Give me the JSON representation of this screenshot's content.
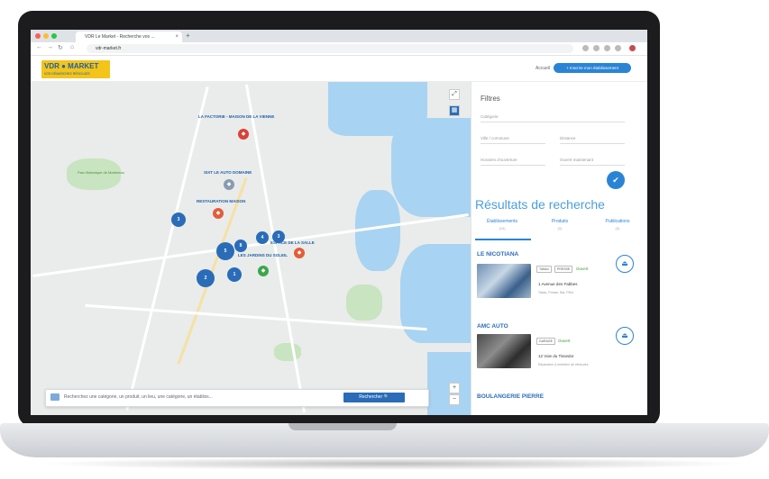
{
  "browser": {
    "tab_title": "VDR Le Market - Recherche vos ...",
    "url": "vdr-market.fr",
    "new_tab": "+"
  },
  "header": {
    "logo_text": "VDR ● MARKET",
    "logo_subtitle": "VOS DÉMARCHES RÉSOLUES",
    "link_label": "Accueil",
    "cta_label": "+ Inscrire mon établissement"
  },
  "map": {
    "labels": [
      "LA FACTORIE - MAISON DE LA VIENNE",
      "SIXT LE AUTO DOMAINE",
      "RESTAURATION MAISON",
      "ESPACE DE LA SALLE",
      "LES JARDINS DU SOLEIL",
      "Parc Botanique de Martineau"
    ],
    "clusters": [
      "3",
      "5",
      "8",
      "4",
      "3",
      "2",
      "1"
    ],
    "search_placeholder": "Recherchez une catégorie, un produit, un lieu, une catégorie, un établiss...",
    "search_button": "Rechercher 🔍",
    "zoom_in": "+",
    "zoom_out": "−"
  },
  "panel": {
    "filters_title": "Filtres",
    "filter_fields": [
      "Catégorie",
      "Ville / commune",
      "Distance",
      "Horaires d'ouverture",
      "Ouvert maintenant"
    ],
    "apply_icon": "✔",
    "results_title": "Résultats de recherche",
    "tabs": [
      {
        "label": "Établissements",
        "count": "(15)"
      },
      {
        "label": "Produits",
        "count": "(0)"
      },
      {
        "label": "Publications",
        "count": "(0)"
      }
    ],
    "results": [
      {
        "name": "LE NICOTIANA",
        "badge1": "TABAC",
        "badge2": "PRESSE",
        "status": "Ouvert",
        "address": "1 Avenue des Fabbes",
        "desc": "Tabac, Presse, Bar, PMU"
      },
      {
        "name": "AMC AUTO",
        "badge1": "GARAGE",
        "badge2": "",
        "status": "Ouvert",
        "address": "12 Voie du Tissedor",
        "desc": "Réparation & entretien de véhicules"
      },
      {
        "name": "BOULANGERIE PIERRE",
        "badge1": "",
        "badge2": "",
        "status": "",
        "address": "",
        "desc": ""
      }
    ],
    "fab_icon": "⏏"
  }
}
